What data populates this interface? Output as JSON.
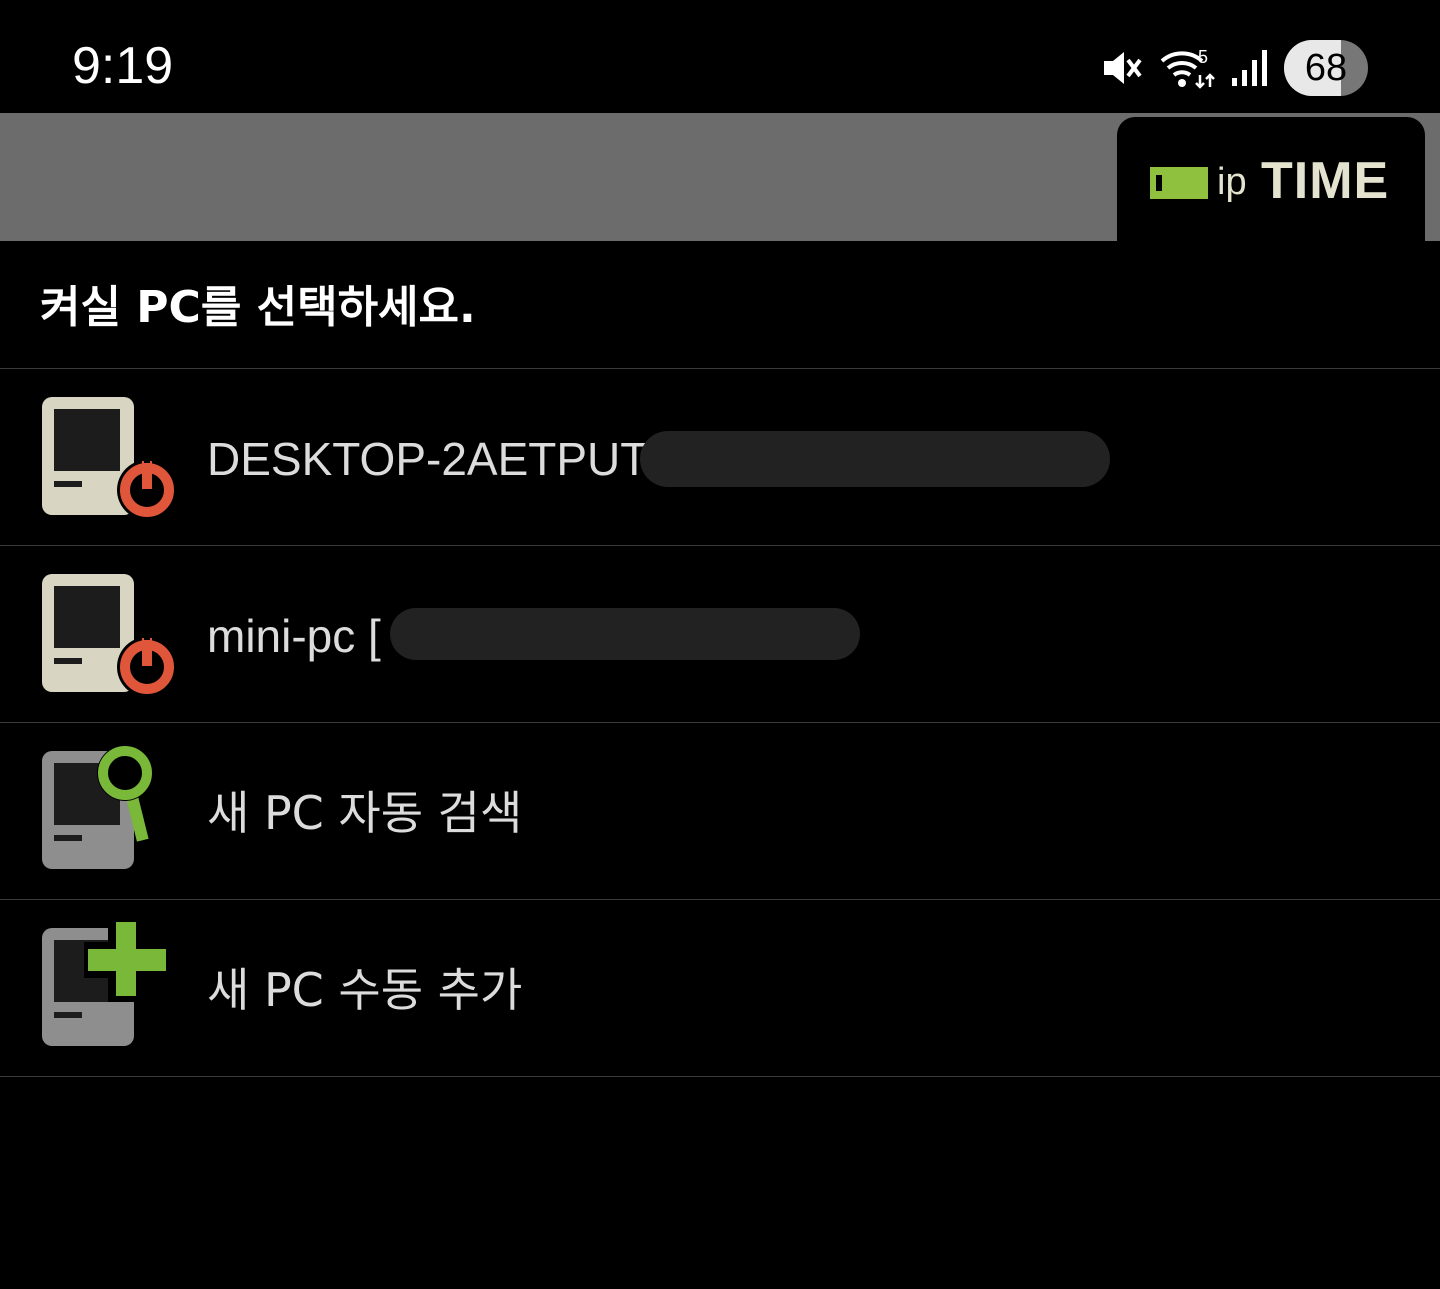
{
  "status_bar": {
    "time": "9:19",
    "battery": 68,
    "icons": [
      "mute-icon",
      "wifi-icon",
      "signal-icon",
      "battery-icon"
    ],
    "wifi_badge": "5"
  },
  "header": {
    "logo_ip": "ip",
    "logo_time": "TIME"
  },
  "title": "켜실 PC를 선택하세요.",
  "list": {
    "items": [
      {
        "label": "DESKTOP-2AETPUT [",
        "icon": "pc-power-icon"
      },
      {
        "label": "mini-pc [",
        "icon": "pc-power-icon"
      },
      {
        "label": "새 PC 자동 검색",
        "icon": "pc-search-icon"
      },
      {
        "label": "새 PC 수동 추가",
        "icon": "pc-add-icon"
      }
    ]
  },
  "colors": {
    "header_band": "#6c6c6c",
    "logo_green": "#8fc13f",
    "pc_beige": "#d8d5c2",
    "pc_gray": "#8e8e8e",
    "power_red": "#e0563a",
    "accent_green": "#7ab83a"
  }
}
